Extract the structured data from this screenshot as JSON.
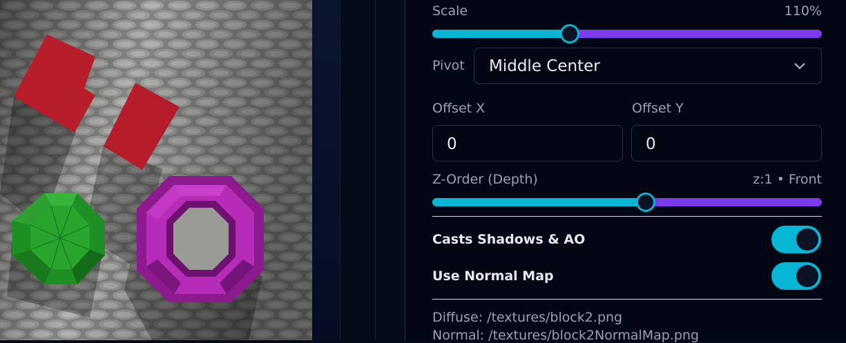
{
  "properties": {
    "scale": {
      "label": "Scale",
      "value_text": "110%",
      "fraction": 0.353
    },
    "pivot": {
      "label": "Pivot",
      "selected": "Middle Center",
      "icon": "chevron-down-icon"
    },
    "offset_x": {
      "label": "Offset X",
      "value": "0"
    },
    "offset_y": {
      "label": "Offset Y",
      "value": "0"
    },
    "z_order": {
      "label": "Z-Order (Depth)",
      "value_text": "z:1 • Front",
      "fraction": 0.548
    },
    "casts_shadows": {
      "label": "Casts Shadows & AO",
      "on": true
    },
    "normal_map": {
      "label": "Use Normal Map",
      "on": true
    },
    "textures": {
      "diffuse": "Diffuse: /textures/block2.png",
      "normal": "Normal: /textures/block2NormalMap.png"
    }
  },
  "colors": {
    "accent_cyan": "#06b6d4",
    "accent_purple": "#7c3aed",
    "panel_bg": "#030713"
  },
  "viewport": {
    "shapes": [
      "red-block",
      "red-block",
      "green-octagon",
      "magenta-ring"
    ],
    "floor_texture": "stone-pavement"
  }
}
